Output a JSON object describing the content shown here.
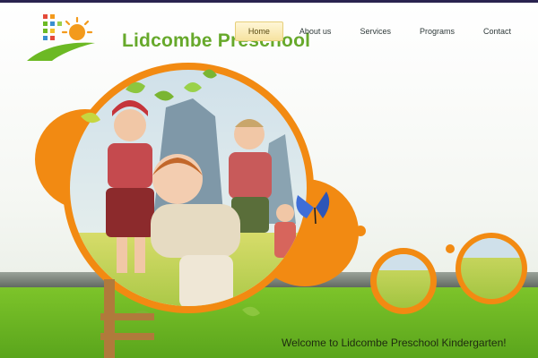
{
  "site": {
    "logo_text": "Lidcombe Preschool"
  },
  "nav": {
    "items": [
      {
        "label": "Home",
        "active": true
      },
      {
        "label": "About us",
        "active": false
      },
      {
        "label": "Services",
        "active": false
      },
      {
        "label": "Programs",
        "active": false
      },
      {
        "label": "Contact",
        "active": false
      }
    ]
  },
  "hero": {
    "welcome_text": "Welcome to Lidcombe Preschool Kindergarten!",
    "accent_color": "#f28a12",
    "green_color": "#6cb924"
  }
}
